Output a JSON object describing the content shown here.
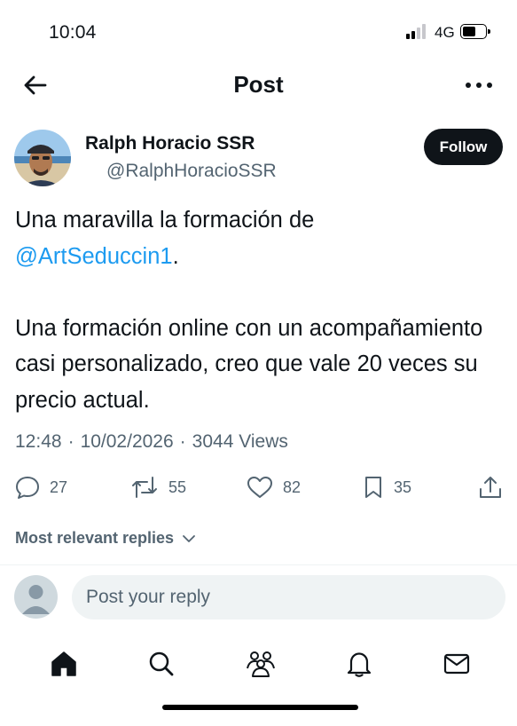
{
  "status_bar": {
    "time": "10:04",
    "network": "4G"
  },
  "header": {
    "title": "Post"
  },
  "author": {
    "display_name": "Ralph Horacio SSR",
    "handle": "@RalphHoracioSSR",
    "follow_label": "Follow"
  },
  "post": {
    "line1": "Una maravilla la formación de",
    "mention": "@ArtSeduccin1",
    "after_mention": ".",
    "paragraph2": "Una formación online con un acompañamiento casi personalizado, creo que vale 20 veces su precio actual."
  },
  "meta": {
    "time": "12:48",
    "date": "10/02/2026",
    "separator": "·",
    "views": "3044 Views"
  },
  "actions": {
    "replies": "27",
    "reposts": "55",
    "likes": "82",
    "bookmarks": "35"
  },
  "replies_sort": {
    "label": "Most relevant replies"
  },
  "reply_bar": {
    "placeholder": "Post your reply"
  },
  "colors": {
    "accent": "#1d9bf0",
    "text": "#0f1419",
    "secondary": "#536471",
    "button_bg": "#0f1419"
  },
  "icons": {
    "back": "arrow-left-icon",
    "more": "more-horizontal-icon",
    "reply": "speech-bubble-icon",
    "repost": "repost-icon",
    "like": "heart-icon",
    "bookmark": "bookmark-icon",
    "share": "share-icon",
    "home": "home-icon",
    "search": "search-icon",
    "communities": "communities-icon",
    "notifications": "bell-icon",
    "messages": "envelope-icon"
  }
}
